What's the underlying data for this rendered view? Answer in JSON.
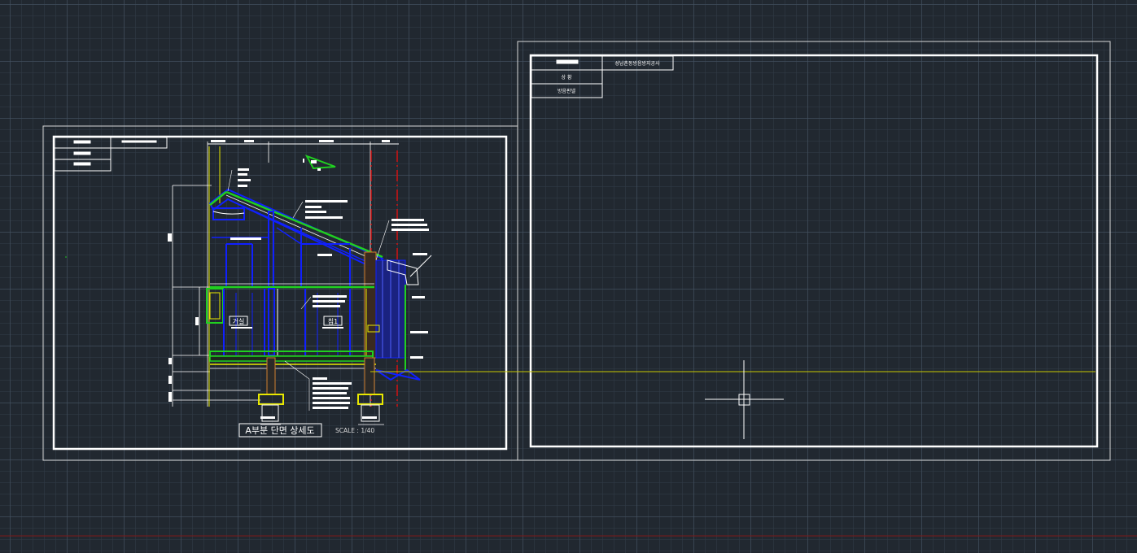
{
  "colors": {
    "background": "#212830",
    "frame": "#ffffff",
    "wall_blue": "#1020ff",
    "green": "#20d020",
    "yellow": "#e8e800",
    "red": "#d01010",
    "crosshair": "#ffffff",
    "ucs_line": "#c8c800"
  },
  "sheet_left": {
    "title": "A부분 단면 상세도",
    "scale": "SCALE : 1/40",
    "room_labels": [
      "거실",
      "침1"
    ]
  },
  "sheet_right": {
    "title_block": {
      "project": "성남촌동방음방지공사",
      "row2": "상 황",
      "row3": "방음판넬"
    }
  },
  "cursor": {
    "type": "crosshair"
  }
}
